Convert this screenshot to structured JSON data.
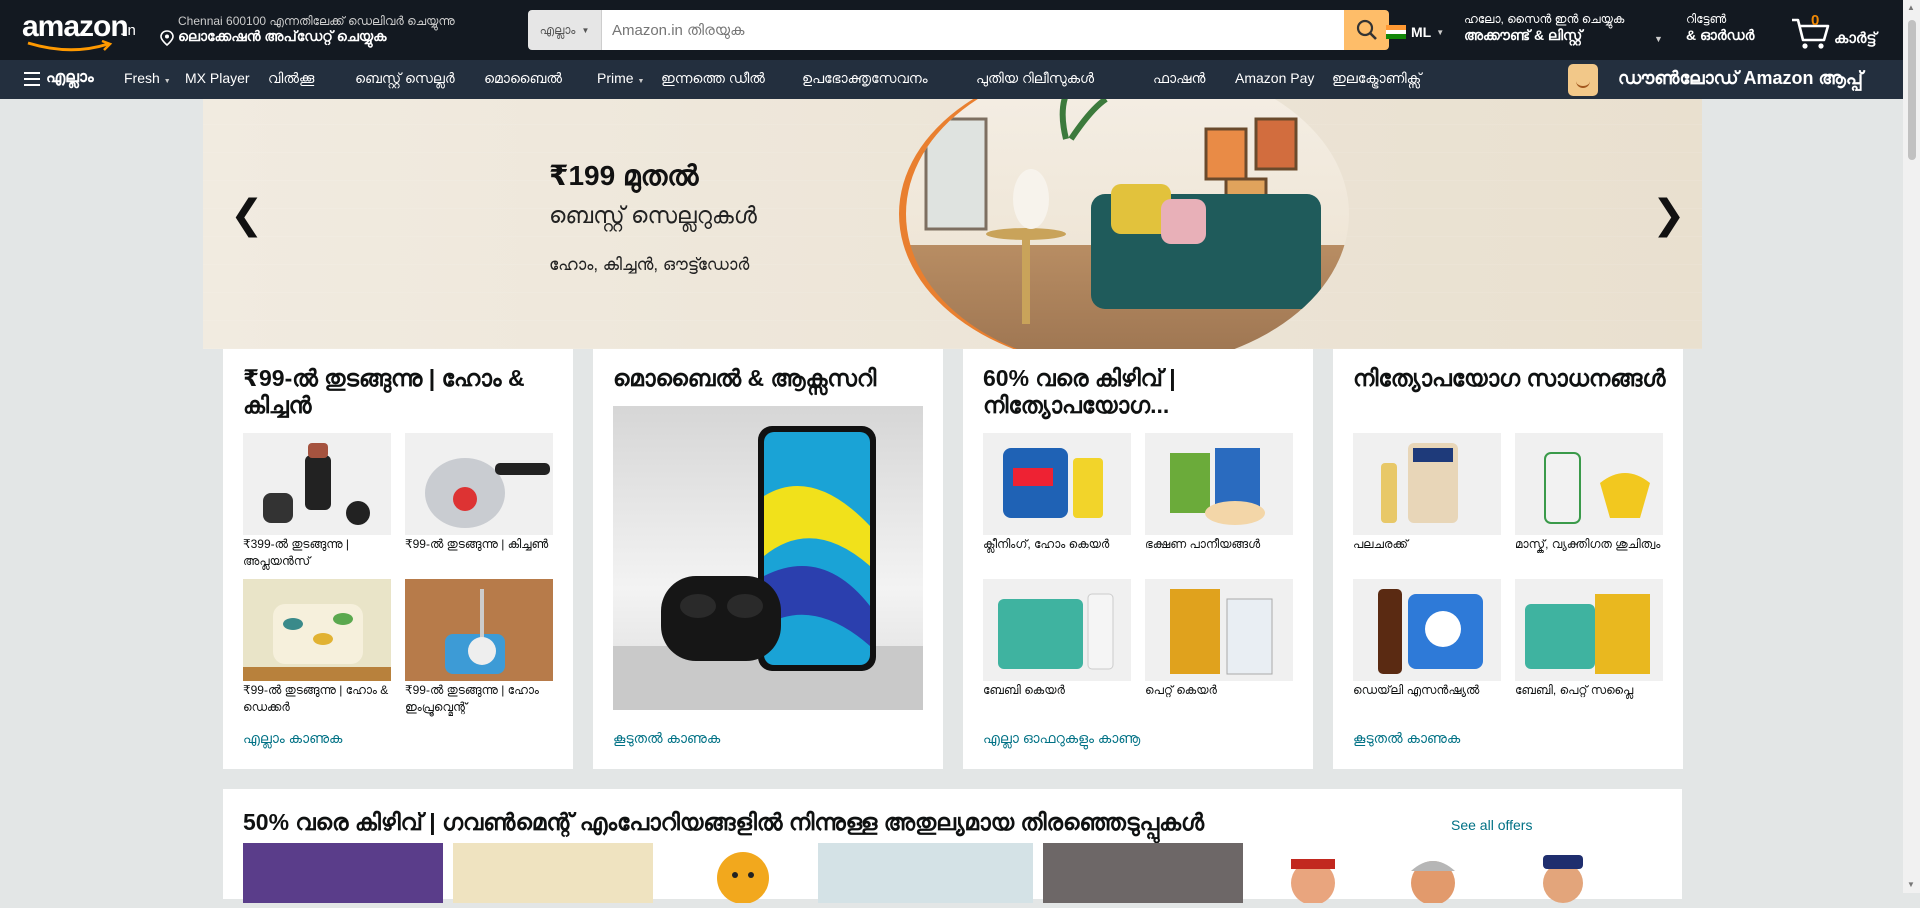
{
  "header": {
    "logo_text": "amazon",
    "logo_suffix": ".in",
    "deliver_line1": "Chennai 600100 എന്നതിലേക്ക് ഡെലിവർ ചെയ്യുന്നു",
    "deliver_line2": "ലൊക്കേഷൻ അപ്‌ഡേറ്റ് ചെയ്യുക",
    "search_category": "എല്ലാം",
    "search_placeholder": "Amazon.in തിരയുക",
    "language": "ML",
    "account_line1": "ഹലോ, സൈൻ ഇൻ ചെയ്യുക",
    "account_line2": "അക്കൗണ്ട് & ലിസ്റ്റ്",
    "orders_line1": "റിട്ടേൺ",
    "orders_line2": "& ഓർഡർ",
    "cart_count": "0",
    "cart_label": "കാർട്ട്"
  },
  "nav": {
    "all": "എല്ലാം",
    "items": [
      "Fresh",
      "MX Player",
      "വിൽക്കൂ",
      "ബെസ്റ്റ് സെല്ലർ",
      "മൊബൈൽ",
      "Prime",
      "ഇന്നത്തെ ഡീൽ",
      "ഉപഭോക്തൃസേവനം",
      "പുതിയ റിലീസുകൾ",
      "ഫാഷൻ",
      "Amazon Pay",
      "ഇലക്ട്രോണിക്സ്"
    ],
    "promo": "ഡൗൺലോഡ് Amazon ആപ്പ്"
  },
  "hero": {
    "price": "₹199 മുതൽ",
    "subtitle": "ബെസ്റ്റ് സെല്ലറുകൾ",
    "tagline": "ഹോം, കിച്ചൻ, ഔട്ട്ഡോർ"
  },
  "cards": [
    {
      "title": "₹99-ൽ തുടങ്ങുന്നു | ഹോം & കിച്ചൻ",
      "tiles": [
        {
          "caption": "₹399-ൽ തുടങ്ങുന്നു | അപ്ലയൻസ്"
        },
        {
          "caption": "₹99-ൽ തുടങ്ങുന്നു | കിച്ചൺ"
        },
        {
          "caption": "₹99-ൽ തുടങ്ങുന്നു | ഹോം & ഡെക്കർ"
        },
        {
          "caption": "₹99-ൽ തുടങ്ങുന്നു | ഹോം ഇംപ്രൂവ്മെന്റ്"
        }
      ],
      "link": "എല്ലാം കാണുക"
    },
    {
      "title": "മൊബൈൽ & ആക്സസറി",
      "link": "കൂടുതൽ കാണുക"
    },
    {
      "title": "60% വരെ കിഴിവ് | നിത്യോപയോഗ...",
      "tiles": [
        {
          "caption": "ക്ലീനിംഗ്, ഹോം കെയർ"
        },
        {
          "caption": "ഭക്ഷണ പാനീയങ്ങൾ"
        },
        {
          "caption": "ബേബി കെയർ"
        },
        {
          "caption": "പെറ്റ് കെയർ"
        }
      ],
      "link": "എല്ലാ ഓഫറുകളും കാണൂ"
    },
    {
      "title": "നിത്യോപയോഗ സാധനങ്ങൾ",
      "tiles": [
        {
          "caption": "പലചരക്ക്"
        },
        {
          "caption": "മാസ്ക്, വ്യക്തിഗത ശുചിത്വം"
        },
        {
          "caption": "ഡെയ്‌ലി എസൻഷ്യൽ"
        },
        {
          "caption": "ബേബി, പെറ്റ് സപ്ലൈ"
        }
      ],
      "link": "കൂടുതൽ കാണുക"
    }
  ],
  "strip": {
    "title": "50% വരെ കിഴിവ് | ഗവൺമെന്റ് എംപോറിയങ്ങളിൽ നിന്നുള്ള അതുല്യമായ തിരഞ്ഞെടുപ്പുകൾ",
    "link": "See all offers"
  },
  "colors": {
    "header_bg": "#131921",
    "nav_bg": "#232f3e",
    "search_button": "#febd69",
    "link": "#007185",
    "cart_count": "#f08804"
  }
}
